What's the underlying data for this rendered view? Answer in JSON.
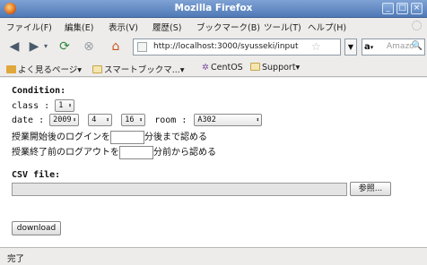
{
  "window": {
    "title": "Mozilla Firefox",
    "minimize": "_",
    "maximize": "□",
    "close": "×"
  },
  "menu": [
    "ファイル(F)",
    "編集(E)",
    "表示(V)",
    "履歴(S)",
    "ブックマーク(B)",
    "ツール(T)",
    "ヘルプ(H)"
  ],
  "nav": {
    "back_icon": "left-arrow-icon",
    "forward_icon": "right-arrow-icon",
    "url": "http://localhost:3000/syusseki/input",
    "search_engine": "a",
    "search_placeholder": "Amazon.co"
  },
  "bookmarks": [
    {
      "label": "よく見るページ▾",
      "icon": "folder-icon"
    },
    {
      "label": "スマートブックマ...▾",
      "icon": "smart-folder-icon"
    },
    {
      "label": "CentOS",
      "icon": "centos-icon"
    },
    {
      "label": "Support▾",
      "icon": "folder-icon"
    }
  ],
  "form": {
    "condition_heading": "Condition:",
    "class_label": "class :",
    "class_value": "1",
    "date_label": "date :",
    "year": "2009",
    "month": "4",
    "day": "16",
    "room_label": "room :",
    "room_value": "A302",
    "login_prefix": "授業開始後のログインを",
    "login_suffix": "分後まで認める",
    "logout_prefix": "授業終了前のログアウトを",
    "logout_suffix": "分前から認める",
    "csv_heading": "CSV file:",
    "browse_label": "参照...",
    "download_label": "download"
  },
  "status": "完了"
}
